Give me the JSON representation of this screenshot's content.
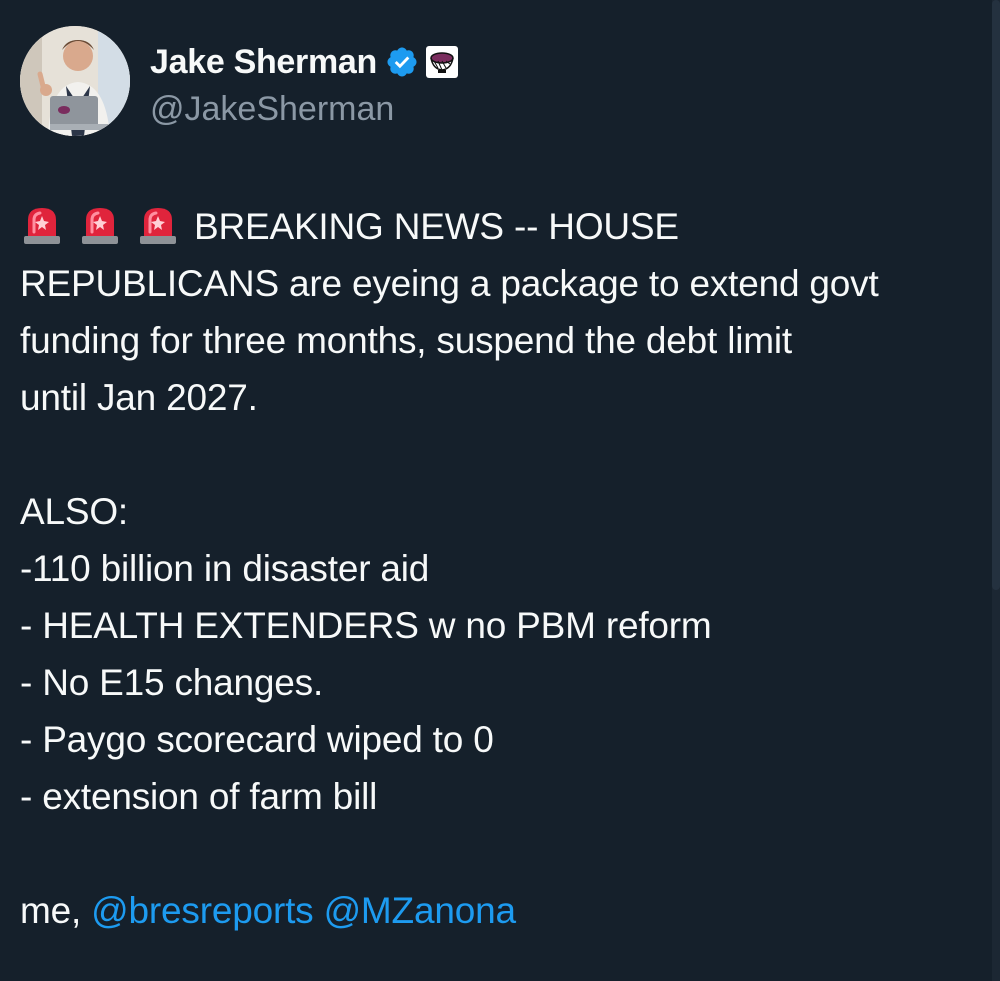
{
  "author": {
    "display_name": "Jake Sherman",
    "handle": "@JakeSherman",
    "verified_icon": "verified-badge-icon",
    "affiliation_icon": "punchbowl-news-logo-icon"
  },
  "tweet": {
    "emoji": [
      "🚨",
      "🚨",
      "🚨"
    ],
    "headline": [
      "BREAKING NEWS -- HOUSE",
      "REPUBLICANS are eyeing a package to extend govt",
      "funding for three months, suspend the debt limit",
      "until Jan 2027."
    ],
    "list_title": "ALSO:",
    "items": [
      "-110 billion in disaster aid",
      "- HEALTH EXTENDERS w no PBM reform",
      "- No E15 changes.",
      "- Paygo scorecard wiped to 0",
      "- extension of farm bill"
    ],
    "credit_prefix": "me, ",
    "mentions": [
      "@bresreports",
      "@MZanona"
    ]
  },
  "colors": {
    "background": "#15202b",
    "text": "#f7f9f9",
    "secondary_text": "#8b98a5",
    "link": "#1d9bf0",
    "verified": "#1d9bf0"
  }
}
